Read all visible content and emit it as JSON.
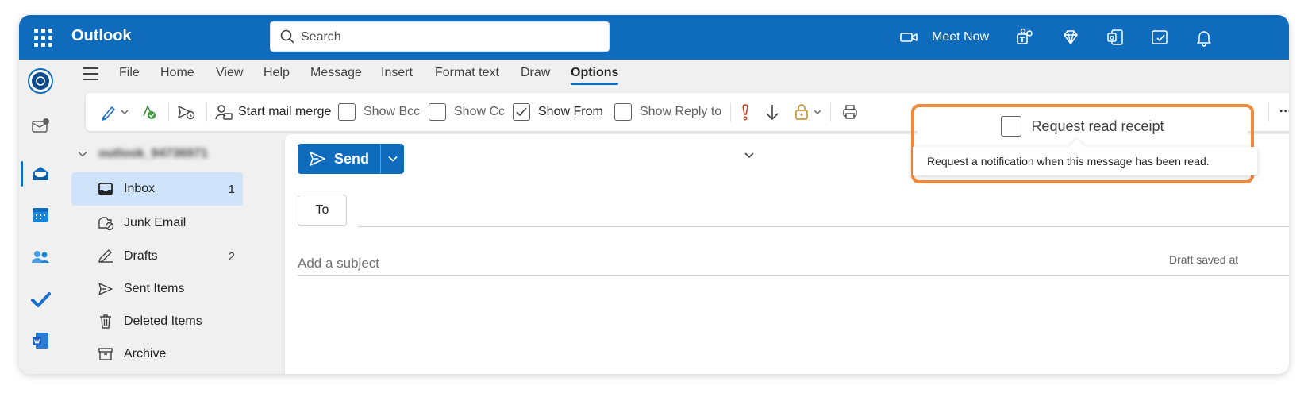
{
  "app": {
    "name": "Outlook"
  },
  "search": {
    "placeholder": "Search"
  },
  "topbar": {
    "meet_now": "Meet Now"
  },
  "ribbon": {
    "tabs": [
      "File",
      "Home",
      "View",
      "Help",
      "Message",
      "Insert",
      "Format text",
      "Draw",
      "Options"
    ],
    "active_tab": "Options",
    "toolbar": {
      "start_mail_merge": "Start mail merge",
      "show_bcc": "Show Bcc",
      "show_cc": "Show Cc",
      "show_from": "Show From",
      "show_reply_to": "Show Reply to",
      "more": "···"
    }
  },
  "tooltip": {
    "title": "Request read receipt",
    "description": "Request a notification when this message has been read."
  },
  "folders": {
    "account": "outlook_94736971",
    "items": [
      {
        "label": "Inbox",
        "count": "1"
      },
      {
        "label": "Junk Email",
        "count": ""
      },
      {
        "label": "Drafts",
        "count": "2"
      },
      {
        "label": "Sent Items",
        "count": ""
      },
      {
        "label": "Deleted Items",
        "count": ""
      },
      {
        "label": "Archive",
        "count": ""
      }
    ]
  },
  "compose": {
    "send_label": "Send",
    "to_label": "To",
    "subject_placeholder": "Add a subject",
    "draft_status": "Draft saved at"
  },
  "colors": {
    "brand": "#0f6cbd",
    "highlight": "#f28a3c",
    "selected_folder": "#cfe4fa"
  }
}
